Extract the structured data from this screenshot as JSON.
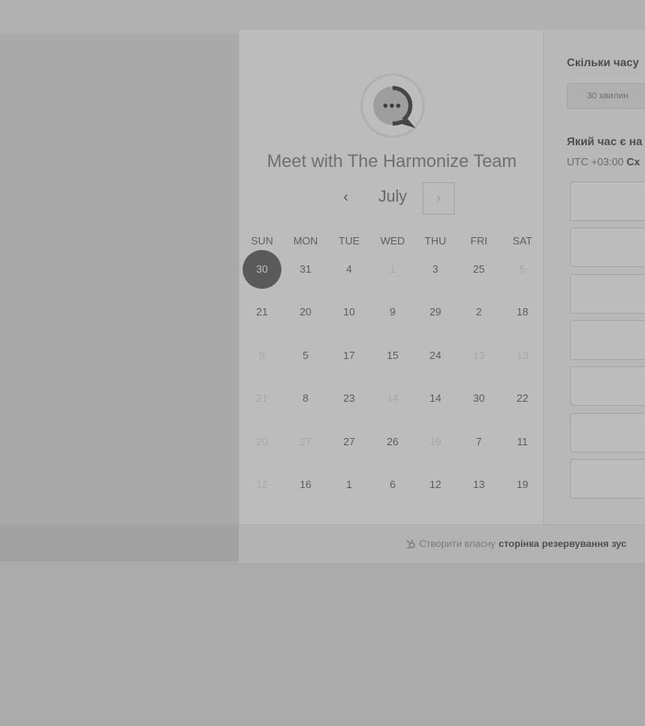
{
  "title": "Meet with The Harmonize Team",
  "calendar": {
    "month": "July",
    "prev_label": "‹",
    "next_label": "›",
    "weekdays": [
      "SUN",
      "MON",
      "TUE",
      "WED",
      "THU",
      "FRI",
      "SAT"
    ],
    "weeks": [
      [
        {
          "d": "30",
          "s": "selected"
        },
        {
          "d": "31",
          "s": "active"
        },
        {
          "d": "4",
          "s": "active"
        },
        {
          "d": "1",
          "s": "inactive"
        },
        {
          "d": "3",
          "s": "active"
        },
        {
          "d": "25",
          "s": "active"
        },
        {
          "d": "5",
          "s": "inactive"
        }
      ],
      [
        {
          "d": "21",
          "s": "active"
        },
        {
          "d": "20",
          "s": "active"
        },
        {
          "d": "10",
          "s": "active"
        },
        {
          "d": "9",
          "s": "active"
        },
        {
          "d": "29",
          "s": "active"
        },
        {
          "d": "2",
          "s": "active"
        },
        {
          "d": "18",
          "s": "active"
        }
      ],
      [
        {
          "d": "9",
          "s": "inactive"
        },
        {
          "d": "5",
          "s": "active"
        },
        {
          "d": "17",
          "s": "active"
        },
        {
          "d": "15",
          "s": "active"
        },
        {
          "d": "24",
          "s": "active"
        },
        {
          "d": "13",
          "s": "inactive"
        },
        {
          "d": "13",
          "s": "inactive"
        }
      ],
      [
        {
          "d": "21",
          "s": "inactive"
        },
        {
          "d": "8",
          "s": "active"
        },
        {
          "d": "23",
          "s": "active"
        },
        {
          "d": "14",
          "s": "inactive"
        },
        {
          "d": "14",
          "s": "active"
        },
        {
          "d": "30",
          "s": "active"
        },
        {
          "d": "22",
          "s": "active"
        }
      ],
      [
        {
          "d": "20",
          "s": "inactive"
        },
        {
          "d": "27",
          "s": "inactive"
        },
        {
          "d": "27",
          "s": "active"
        },
        {
          "d": "26",
          "s": "active"
        },
        {
          "d": "19",
          "s": "inactive"
        },
        {
          "d": "7",
          "s": "active"
        },
        {
          "d": "11",
          "s": "active"
        }
      ],
      [
        {
          "d": "12",
          "s": "inactive"
        },
        {
          "d": "16",
          "s": "active"
        },
        {
          "d": "1",
          "s": "active"
        },
        {
          "d": "6",
          "s": "active"
        },
        {
          "d": "12",
          "s": "active"
        },
        {
          "d": "13",
          "s": "active"
        },
        {
          "d": "19",
          "s": "active"
        }
      ]
    ]
  },
  "right_panel": {
    "duration_heading": "Скільки часу",
    "duration_option": "30 хвилин",
    "time_heading": "Який час є на",
    "timezone_prefix": "UTC +03:00",
    "timezone_name": "Сх",
    "slot_count": 7
  },
  "footer": {
    "text": "Створити власну",
    "link": "сторінка резервування зус"
  },
  "colors": {
    "selected_day": "#5a5a5a",
    "overlay_bg": "#ababab"
  }
}
